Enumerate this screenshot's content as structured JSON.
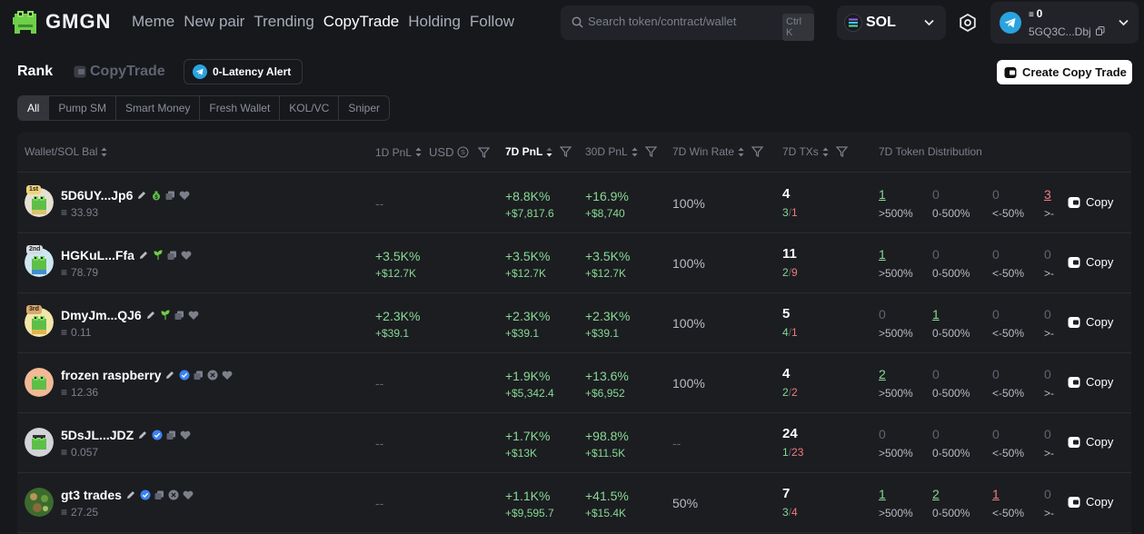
{
  "topbar": {
    "logo_text": "GMGN",
    "nav": [
      {
        "label": "Meme",
        "active": false
      },
      {
        "label": "New pair",
        "active": false
      },
      {
        "label": "Trending",
        "active": false
      },
      {
        "label": "CopyTrade",
        "active": true
      },
      {
        "label": "Holding",
        "active": false
      },
      {
        "label": "Follow",
        "active": false
      }
    ],
    "search": {
      "placeholder": "Search token/contract/wallet",
      "shortcut": "Ctrl K"
    },
    "chain": {
      "label": "SOL"
    },
    "wallet": {
      "balance": "0",
      "address": "5GQ3C...Dbj"
    }
  },
  "subheader": {
    "rank_title": "Rank",
    "copytrade_label": "CopyTrade",
    "alert_label": "0-Latency Alert",
    "create_label": "Create Copy Trade"
  },
  "filters": [
    "All",
    "Pump SM",
    "Smart Money",
    "Fresh Wallet",
    "KOL/VC",
    "Sniper"
  ],
  "columns": {
    "wallet": "Wallet/SOL Bal",
    "pnl1d": "1D PnL",
    "usd": "USD",
    "pnl7d": "7D PnL",
    "pnl30d": "30D PnL",
    "winrate": "7D Win Rate",
    "txs": "7D TXs",
    "dist": "7D Token Distribution"
  },
  "copy_label": "Copy",
  "rows": [
    {
      "rank": "1st",
      "name": "5D6UY...Jp6",
      "bal": "33.93",
      "d1_pct": "--",
      "d1_usd": "",
      "d7_pct": "+8.8K%",
      "d7_usd": "+$7,817.6",
      "d30_pct": "+16.9%",
      "d30_usd": "+$8,740",
      "win": "100%",
      "tx_total": "4",
      "tx_buy": "3",
      "tx_sell": "1",
      "dist": [
        "1",
        "0",
        "0",
        "3"
      ],
      "dist_labels": [
        ">500%",
        "0-500%",
        "<-50%",
        ">-"
      ]
    },
    {
      "rank": "2nd",
      "name": "HGKuL...Ffa",
      "bal": "78.79",
      "d1_pct": "+3.5K%",
      "d1_usd": "+$12.7K",
      "d7_pct": "+3.5K%",
      "d7_usd": "+$12.7K",
      "d30_pct": "+3.5K%",
      "d30_usd": "+$12.7K",
      "win": "100%",
      "tx_total": "11",
      "tx_buy": "2",
      "tx_sell": "9",
      "dist": [
        "1",
        "0",
        "0",
        "0"
      ],
      "dist_labels": [
        ">500%",
        "0-500%",
        "<-50%",
        ">-"
      ]
    },
    {
      "rank": "3rd",
      "name": "DmyJm...QJ6",
      "bal": "0.11",
      "d1_pct": "+2.3K%",
      "d1_usd": "+$39.1",
      "d7_pct": "+2.3K%",
      "d7_usd": "+$39.1",
      "d30_pct": "+2.3K%",
      "d30_usd": "+$39.1",
      "win": "100%",
      "tx_total": "5",
      "tx_buy": "4",
      "tx_sell": "1",
      "dist": [
        "0",
        "1",
        "0",
        "0"
      ],
      "dist_labels": [
        ">500%",
        "0-500%",
        "<-50%",
        ">-"
      ]
    },
    {
      "rank": "",
      "name": "frozen raspberry",
      "bal": "12.36",
      "d1_pct": "--",
      "d1_usd": "",
      "d7_pct": "+1.9K%",
      "d7_usd": "+$5,342.4",
      "d30_pct": "+13.6%",
      "d30_usd": "+$6,952",
      "win": "100%",
      "tx_total": "4",
      "tx_buy": "2",
      "tx_sell": "2",
      "dist": [
        "2",
        "0",
        "0",
        "0"
      ],
      "dist_labels": [
        ">500%",
        "0-500%",
        "<-50%",
        ">-"
      ]
    },
    {
      "rank": "",
      "name": "5DsJL...JDZ",
      "bal": "0.057",
      "d1_pct": "--",
      "d1_usd": "",
      "d7_pct": "+1.7K%",
      "d7_usd": "+$13K",
      "d30_pct": "+98.8%",
      "d30_usd": "+$11.5K",
      "win": "--",
      "tx_total": "24",
      "tx_buy": "1",
      "tx_sell": "23",
      "dist": [
        "0",
        "0",
        "0",
        "0"
      ],
      "dist_labels": [
        ">500%",
        "0-500%",
        "<-50%",
        ">-"
      ]
    },
    {
      "rank": "",
      "name": "gt3 trades",
      "bal": "27.25",
      "d1_pct": "--",
      "d1_usd": "",
      "d7_pct": "+1.1K%",
      "d7_usd": "+$9,595.7",
      "d30_pct": "+41.5%",
      "d30_usd": "+$15.4K",
      "win": "50%",
      "tx_total": "7",
      "tx_buy": "3",
      "tx_sell": "4",
      "dist": [
        "1",
        "2",
        "1",
        "0"
      ],
      "dist_labels": [
        ">500%",
        "0-500%",
        "<-50%",
        ">-"
      ]
    }
  ],
  "colors": {
    "positive": "#86d993",
    "negative": "#f07c82",
    "accent": "#2aa3e0",
    "verified": "#3b82f6"
  }
}
